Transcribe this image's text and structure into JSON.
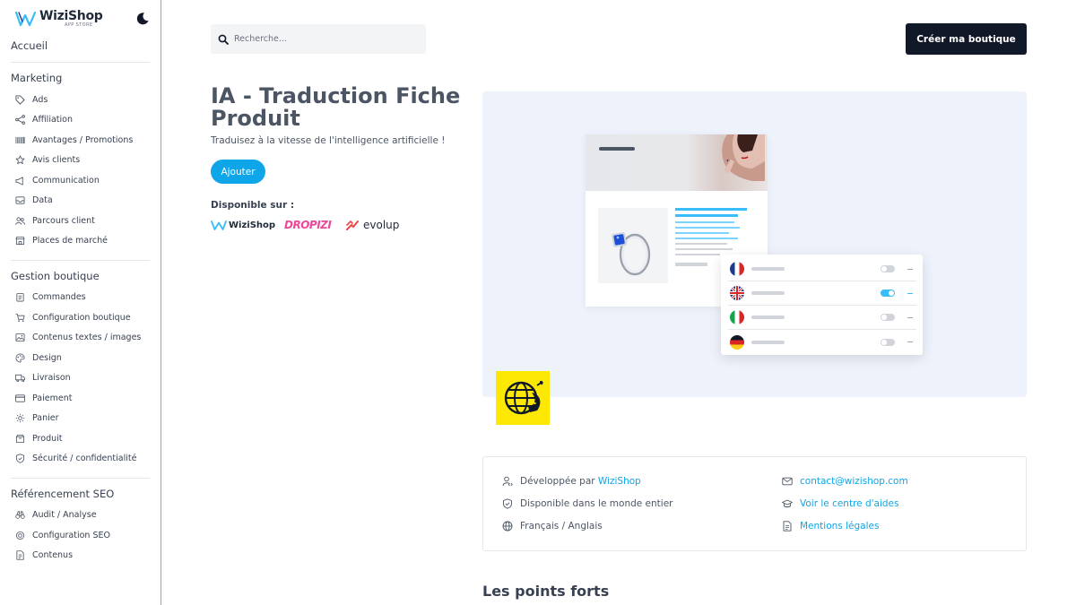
{
  "brand": {
    "name": "WiziShop",
    "sub": "APP STORE"
  },
  "sidebar": {
    "home": "Accueil",
    "sections": [
      {
        "title": "Marketing",
        "items": [
          {
            "label": "Ads",
            "icon": "tag-icon"
          },
          {
            "label": "Affiliation",
            "icon": "share-icon"
          },
          {
            "label": "Avantages / Promotions",
            "icon": "barcode-icon"
          },
          {
            "label": "Avis clients",
            "icon": "star-icon"
          },
          {
            "label": "Communication",
            "icon": "megaphone-icon"
          },
          {
            "label": "Data",
            "icon": "inbox-icon"
          },
          {
            "label": "Parcours client",
            "icon": "users-icon"
          },
          {
            "label": "Places de marché",
            "icon": "store-icon"
          }
        ]
      },
      {
        "title": "Gestion boutique",
        "items": [
          {
            "label": "Commandes",
            "icon": "clipboard-icon"
          },
          {
            "label": "Configuration boutique",
            "icon": "cart-icon"
          },
          {
            "label": "Contenus textes / images",
            "icon": "image-icon"
          },
          {
            "label": "Design",
            "icon": "palette-icon"
          },
          {
            "label": "Livraison",
            "icon": "truck-icon"
          },
          {
            "label": "Paiement",
            "icon": "credit-card-icon"
          },
          {
            "label": "Panier",
            "icon": "gear-icon"
          },
          {
            "label": "Produit",
            "icon": "box-icon"
          },
          {
            "label": "Sécurité / confidentialité",
            "icon": "shield-icon"
          }
        ]
      },
      {
        "title": "Référencement SEO",
        "items": [
          {
            "label": "Audit / Analyse",
            "icon": "binoculars-icon"
          },
          {
            "label": "Configuration SEO",
            "icon": "settings-icon"
          },
          {
            "label": "Contenus",
            "icon": "document-icon"
          }
        ]
      }
    ]
  },
  "search": {
    "placeholder": "Recherche..."
  },
  "header": {
    "create_label": "Créer ma boutique"
  },
  "app": {
    "title": "IA - Traduction Fiche Produit",
    "subtitle": "Traduisez à la vitesse de l'intelligence artificielle !",
    "add_label": "Ajouter",
    "available_label": "Disponible sur :",
    "platforms": [
      "WiziShop",
      "DROPIZI",
      "evolup"
    ]
  },
  "info": {
    "developer_prefix": "Développée par",
    "developer_link": "WiziShop",
    "availability": "Disponible dans le monde entier",
    "languages": "Français / Anglais",
    "contact": "contact@wizishop.com",
    "help": "Voir le centre d'aides",
    "legal": "Mentions légales"
  },
  "points_title": "Les points forts",
  "colors": {
    "accent": "#0ea5e9",
    "dark_button": "#111827",
    "app_icon_bg": "#fde804",
    "hero_bg": "#eef2fb"
  }
}
